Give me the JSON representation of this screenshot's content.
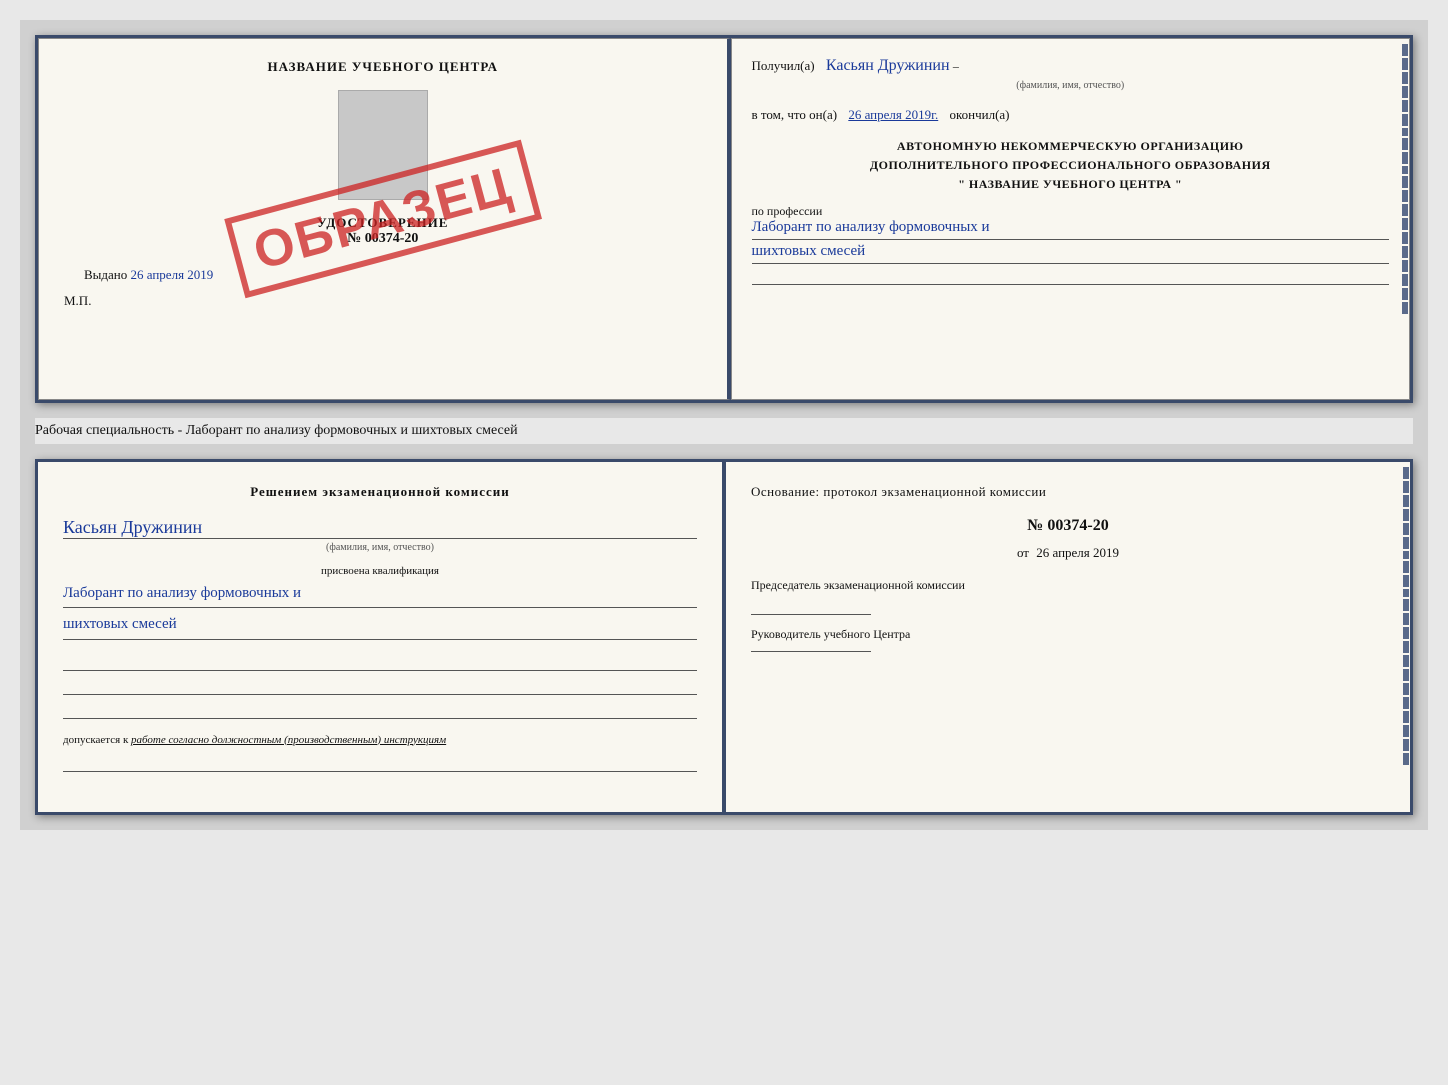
{
  "page": {
    "background": "#d0d0d0"
  },
  "top_cert": {
    "left": {
      "title": "НАЗВАНИЕ УЧЕБНОГО ЦЕНТРА",
      "udostoverenie_label": "УДОСТОВЕРЕНИЕ",
      "number": "№ 00374-20",
      "vydano_label": "Выдано",
      "vydano_date": "26 апреля 2019",
      "mp_label": "М.П.",
      "obrazets": "ОБРАЗЕЦ"
    },
    "right": {
      "received_label": "Получил(а)",
      "name_handwritten": "Касьян Дружинин",
      "fio_label": "(фамилия, имя, отчество)",
      "in_that_label": "в том, что он(а)",
      "date_handwritten": "26 апреля 2019г.",
      "okonchil_label": "окончил(а)",
      "org_line1": "АВТОНОМНУЮ НЕКОММЕРЧЕСКУЮ ОРГАНИЗАЦИЮ",
      "org_line2": "ДОПОЛНИТЕЛЬНОГО ПРОФЕССИОНАЛЬНОГО ОБРАЗОВАНИЯ",
      "org_line3": "\"  НАЗВАНИЕ УЧЕБНОГО ЦЕНТРА  \"",
      "po_professii_label": "по профессии",
      "profession_handwritten_1": "Лаборант по анализу формовочных и",
      "profession_handwritten_2": "шихтовых смесей"
    }
  },
  "middle": {
    "text": "Рабочая специальность - Лаборант по анализу формовочных и шихтовых смесей"
  },
  "bottom_cert": {
    "left": {
      "decision_title": "Решением экзаменационной комиссии",
      "name_handwritten": "Касьян Дружинин",
      "fio_small": "(фамилия, имя, отчество)",
      "prisvoena_label": "присвоена квалификация",
      "qualification_line1": "Лаборант по анализу формовочных и",
      "qualification_line2": "шихтовых смесей",
      "dopuskaetsya_label": "допускается к",
      "dopuskaetsya_text": "работе согласно должностным (производственным) инструкциям"
    },
    "right": {
      "osnovaniye_label": "Основание: протокол экзаменационной комиссии",
      "protocol_number": "№ 00374-20",
      "ot_label": "от",
      "ot_date": "26 апреля 2019",
      "chairman_label": "Председатель экзаменационной комиссии",
      "rukovoditel_label": "Руководитель учебного Центра"
    }
  }
}
